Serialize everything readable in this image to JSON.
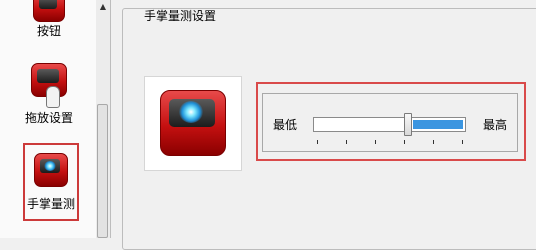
{
  "sidebar": {
    "items": [
      {
        "label": "按钮",
        "icon": "button-icon"
      },
      {
        "label": "拖放设置",
        "icon": "drag-hand-icon"
      },
      {
        "label": "手掌量测",
        "icon": "palm-measure-icon",
        "selected": true
      }
    ]
  },
  "group": {
    "title": "手掌量测设置"
  },
  "preview": {
    "icon": "palm-measure-icon"
  },
  "slider": {
    "min_label": "最低",
    "max_label": "最高",
    "value_fraction": 0.62,
    "tick_count": 6,
    "accent_color": "#3b95e0"
  },
  "colors": {
    "selection_outline": "#d94a4a",
    "icon_red": "#c41010"
  }
}
